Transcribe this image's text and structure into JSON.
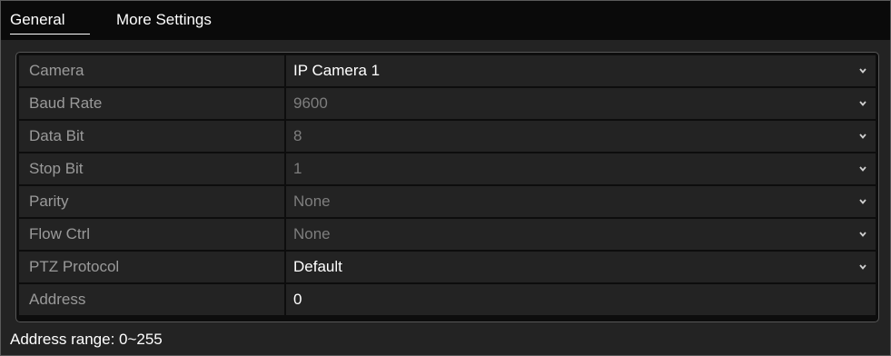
{
  "tabs": [
    {
      "label": "General",
      "active": true
    },
    {
      "label": "More Settings",
      "active": false
    }
  ],
  "rows": [
    {
      "label": "Camera",
      "value": "IP Camera 1",
      "active": true,
      "dropdown": true
    },
    {
      "label": "Baud Rate",
      "value": "9600",
      "active": false,
      "dropdown": true
    },
    {
      "label": "Data Bit",
      "value": "8",
      "active": false,
      "dropdown": true
    },
    {
      "label": "Stop Bit",
      "value": "1",
      "active": false,
      "dropdown": true
    },
    {
      "label": "Parity",
      "value": "None",
      "active": false,
      "dropdown": true
    },
    {
      "label": "Flow Ctrl",
      "value": "None",
      "active": false,
      "dropdown": true
    },
    {
      "label": "PTZ Protocol",
      "value": "Default",
      "active": true,
      "dropdown": true
    },
    {
      "label": "Address",
      "value": "0",
      "active": true,
      "dropdown": false
    }
  ],
  "footer": {
    "text": "Address range: 0~255"
  },
  "colors": {
    "background": "#232323",
    "tabbar": "#0a0a0a",
    "text_active": "#ffffff",
    "text_disabled": "#7e7e7e",
    "label_text": "#9a9a9a"
  }
}
